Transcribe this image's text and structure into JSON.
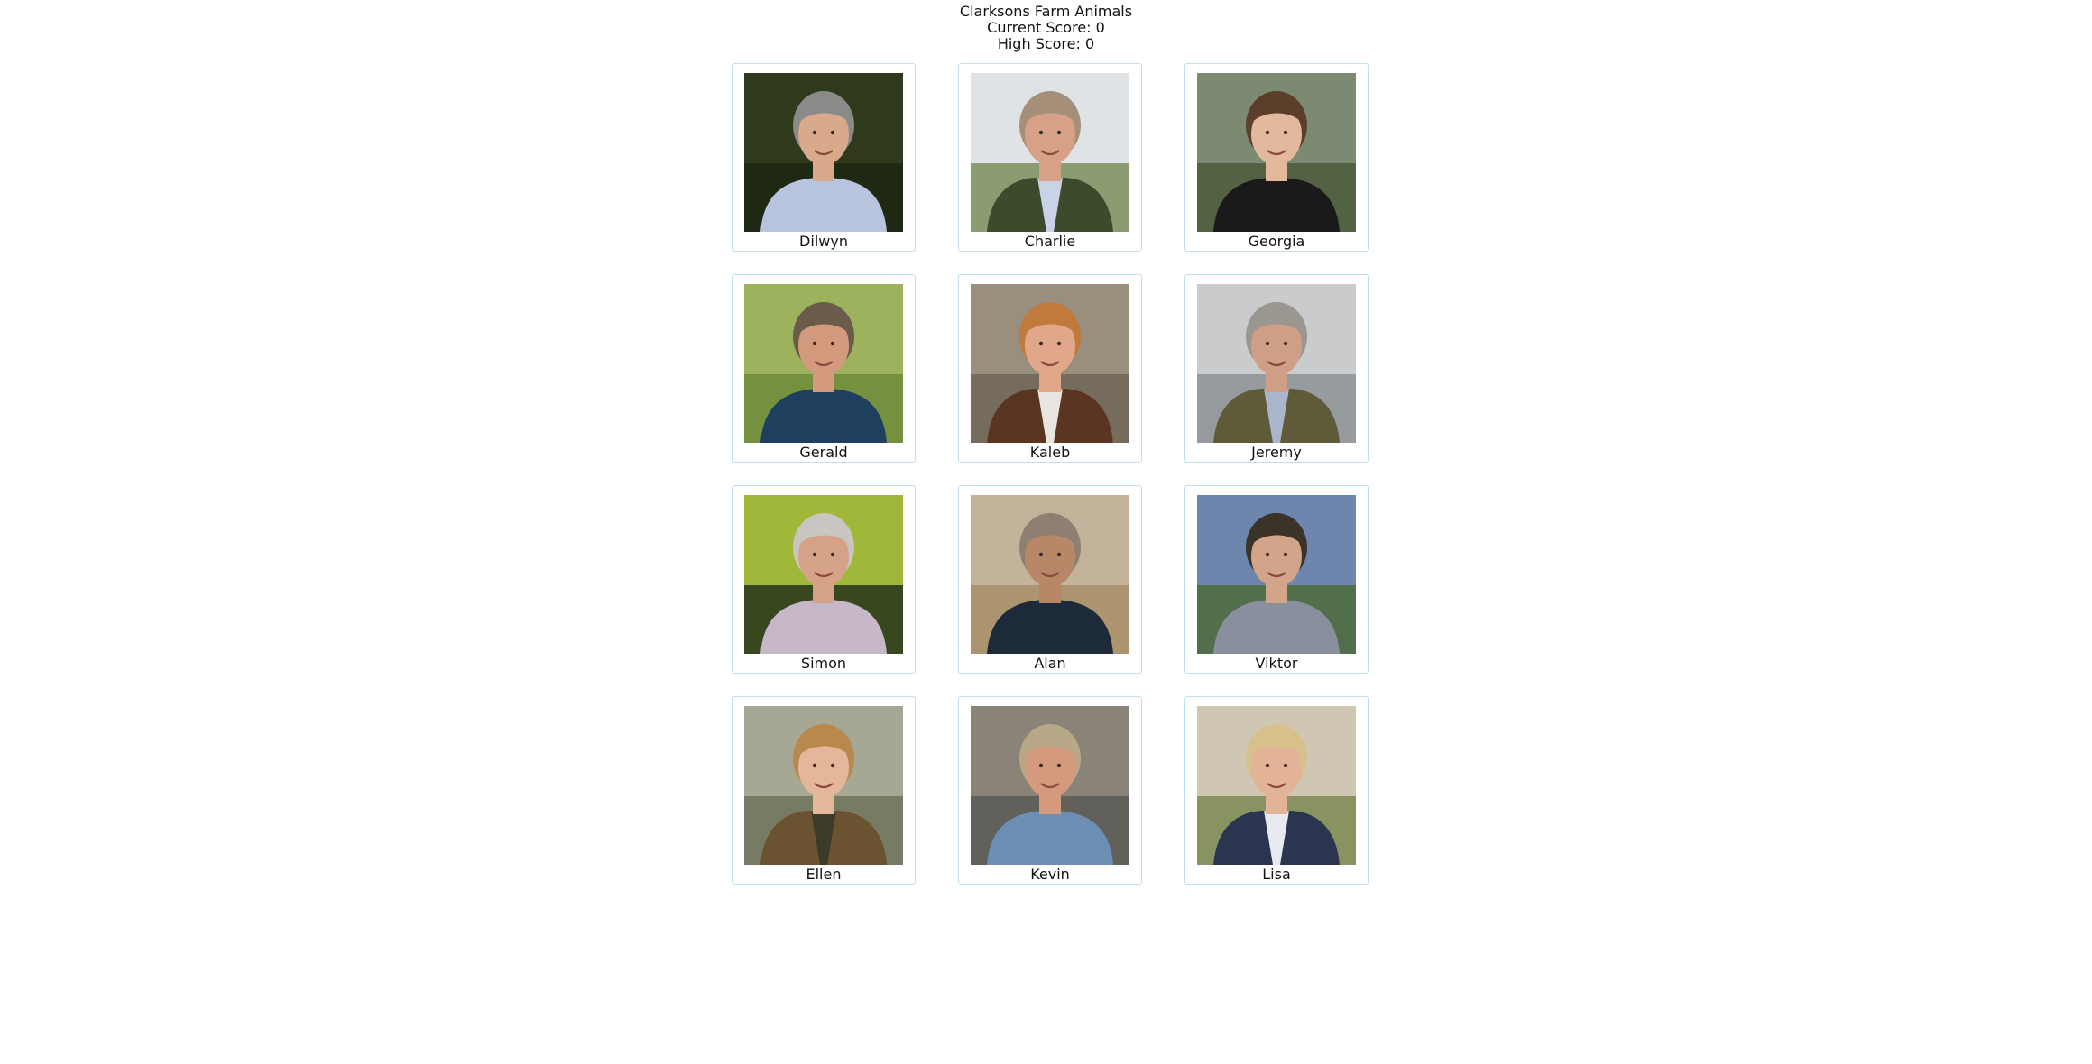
{
  "header": {
    "title": "Clarksons Farm Animals",
    "current_score": "Current Score: 0",
    "high_score": "High Score: 0"
  },
  "cards": [
    {
      "name": "Dilwyn",
      "photo": {
        "bg": "#2f3a1c",
        "bg2": "#1c2612",
        "hair": "#8a8a88",
        "skin": "#d9a98c",
        "shirt": "#b8c3de",
        "jacket": null
      }
    },
    {
      "name": "Charlie",
      "photo": {
        "bg": "#dfe3e6",
        "bg2": "#7c8f5a",
        "hair": "#a58f78",
        "skin": "#d7a187",
        "shirt": "#c9d2e6",
        "jacket": "#3e4a2c"
      }
    },
    {
      "name": "Georgia",
      "photo": {
        "bg": "#7b8a70",
        "bg2": "#4d5b3c",
        "hair": "#5b3f2b",
        "skin": "#e2b99d",
        "shirt": "#1a1a1c",
        "jacket": null
      }
    },
    {
      "name": "Gerald",
      "photo": {
        "bg": "#9cb25d",
        "bg2": "#6f8a3a",
        "hair": "#6a5b4a",
        "skin": "#d39a7e",
        "shirt": "#1f3f5f",
        "jacket": null
      }
    },
    {
      "name": "Kaleb",
      "photo": {
        "bg": "#9a8e7c",
        "bg2": "#6e6658",
        "hair": "#c07a3c",
        "skin": "#e0a78a",
        "shirt": "#e9e5e0",
        "jacket": "#5a3522"
      }
    },
    {
      "name": "Jeremy",
      "photo": {
        "bg": "#c9cbcc",
        "bg2": "#8c9396",
        "hair": "#9a9690",
        "skin": "#cf9e86",
        "shirt": "#a9b6cc",
        "jacket": "#5f5a38"
      }
    },
    {
      "name": "Simon",
      "photo": {
        "bg": "#9fb83a",
        "bg2": "#27321a",
        "hair": "#c9c6c2",
        "skin": "#d5a288",
        "shirt": "#c6b8c6",
        "jacket": null
      }
    },
    {
      "name": "Alan",
      "photo": {
        "bg": "#c2b39a",
        "bg2": "#a88e6a",
        "hair": "#8d7f72",
        "skin": "#b88768",
        "shirt": "#1d2a3a",
        "jacket": null
      }
    },
    {
      "name": "Viktor",
      "photo": {
        "bg": "#6c86ad",
        "bg2": "#4e6b3a",
        "hair": "#3b3228",
        "skin": "#d2a58a",
        "shirt": "#8a8f9e",
        "jacket": null
      }
    },
    {
      "name": "Ellen",
      "photo": {
        "bg": "#a6a894",
        "bg2": "#6f735c",
        "hair": "#b9884c",
        "skin": "#e4b69a",
        "shirt": "#3c3a28",
        "jacket": "#6b5230"
      }
    },
    {
      "name": "Kevin",
      "photo": {
        "bg": "#8a8378",
        "bg2": "#5b5a56",
        "hair": "#b9a887",
        "skin": "#d59a7d",
        "shirt": "#6d8eb3",
        "jacket": null
      }
    },
    {
      "name": "Lisa",
      "photo": {
        "bg": "#cfc6b4",
        "bg2": "#7c8a52",
        "hair": "#d8c08a",
        "skin": "#e3b398",
        "shirt": "#e7ebf1",
        "jacket": "#2b3550"
      }
    }
  ]
}
